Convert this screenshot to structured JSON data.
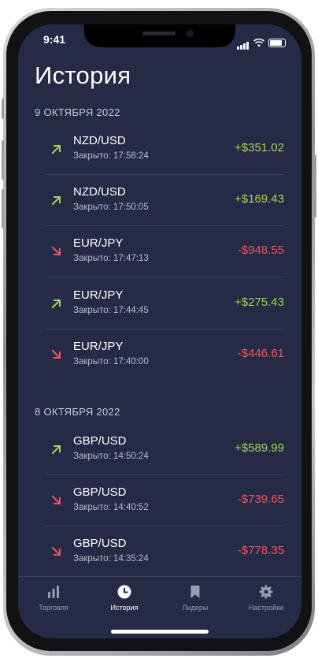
{
  "status_bar": {
    "time": "9:41"
  },
  "page_title": "История",
  "groups": [
    {
      "date": "9 ОКТЯБРЯ 2022",
      "trades": [
        {
          "pair": "NZD/USD",
          "closed": "Закрыто: 17:58:24",
          "amount": "+$351.02",
          "direction": "up"
        },
        {
          "pair": "NZD/USD",
          "closed": "Закрыто: 17:50:05",
          "amount": "+$169.43",
          "direction": "up"
        },
        {
          "pair": "EUR/JPY",
          "closed": "Закрыто: 17:47:13",
          "amount": "-$948.55",
          "direction": "down"
        },
        {
          "pair": "EUR/JPY",
          "closed": "Закрыто: 17:44:45",
          "amount": "+$275.43",
          "direction": "up"
        },
        {
          "pair": "EUR/JPY",
          "closed": "Закрыто: 17:40:00",
          "amount": "-$446.61",
          "direction": "down"
        }
      ]
    },
    {
      "date": "8 ОКТЯБРЯ 2022",
      "trades": [
        {
          "pair": "GBP/USD",
          "closed": "Закрыто: 14:50:24",
          "amount": "+$589.99",
          "direction": "up"
        },
        {
          "pair": "GBP/USD",
          "closed": "Закрыто: 14:40:52",
          "amount": "-$739.65",
          "direction": "down"
        },
        {
          "pair": "GBP/USD",
          "closed": "Закрыто: 14:35:24",
          "amount": "-$778.35",
          "direction": "down"
        }
      ]
    }
  ],
  "tabbar": {
    "items": [
      {
        "label": "Торговля",
        "icon": "bar-chart-icon"
      },
      {
        "label": "История",
        "icon": "clock-icon",
        "active": true
      },
      {
        "label": "Лидеры",
        "icon": "bookmark-icon"
      },
      {
        "label": "Настройки",
        "icon": "gear-icon"
      }
    ]
  },
  "colors": {
    "background": "#252a47",
    "positive": "#a3d455",
    "negative": "#f0545f"
  }
}
